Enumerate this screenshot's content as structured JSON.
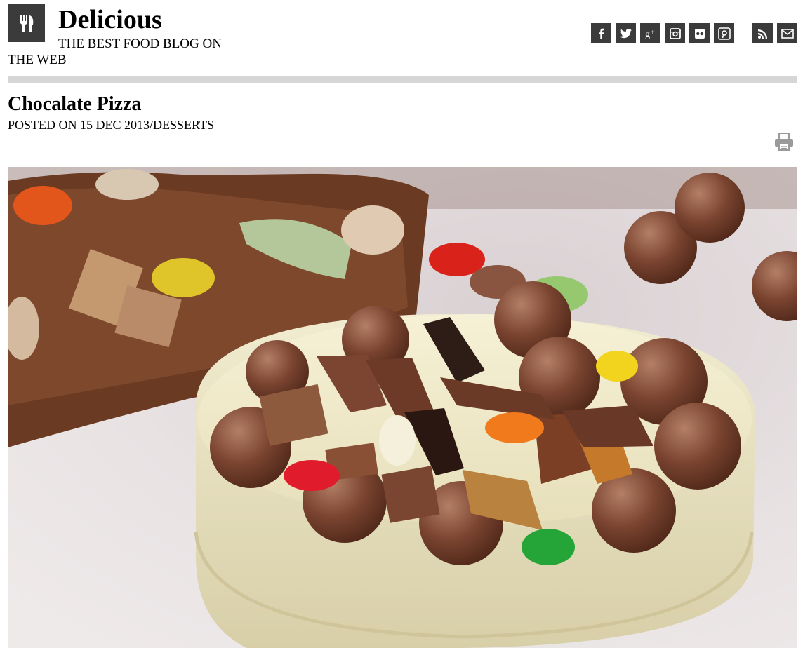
{
  "site": {
    "title": "Delicious",
    "tagline": "THE BEST FOOD BLOG ON THE WEB",
    "logo_icon": "fork-knife-icon"
  },
  "social": [
    {
      "name": "facebook",
      "icon": "facebook-icon",
      "glyph": "f"
    },
    {
      "name": "twitter",
      "icon": "twitter-icon",
      "glyph": ""
    },
    {
      "name": "google-plus",
      "icon": "google-plus-icon",
      "glyph": "g+"
    },
    {
      "name": "instagram",
      "icon": "instagram-icon",
      "glyph": ""
    },
    {
      "name": "flickr",
      "icon": "flickr-icon",
      "glyph": ""
    },
    {
      "name": "pinterest",
      "icon": "pinterest-icon",
      "glyph": "P"
    },
    {
      "name": "rss",
      "icon": "rss-icon",
      "glyph": ""
    },
    {
      "name": "email",
      "icon": "mail-icon",
      "glyph": ""
    }
  ],
  "post": {
    "title": "Chocalate Pizza",
    "posted_prefix": "POSTED ON",
    "date": "15 DEC 2013",
    "separator": "/",
    "category": "DESSERTS",
    "print_icon": "print-icon",
    "image_subject": "white chocolate pizza topped with chocolates"
  },
  "colors": {
    "icon_bg": "#3b3b3b",
    "divider": "#d6d6d6",
    "text": "#000000"
  }
}
